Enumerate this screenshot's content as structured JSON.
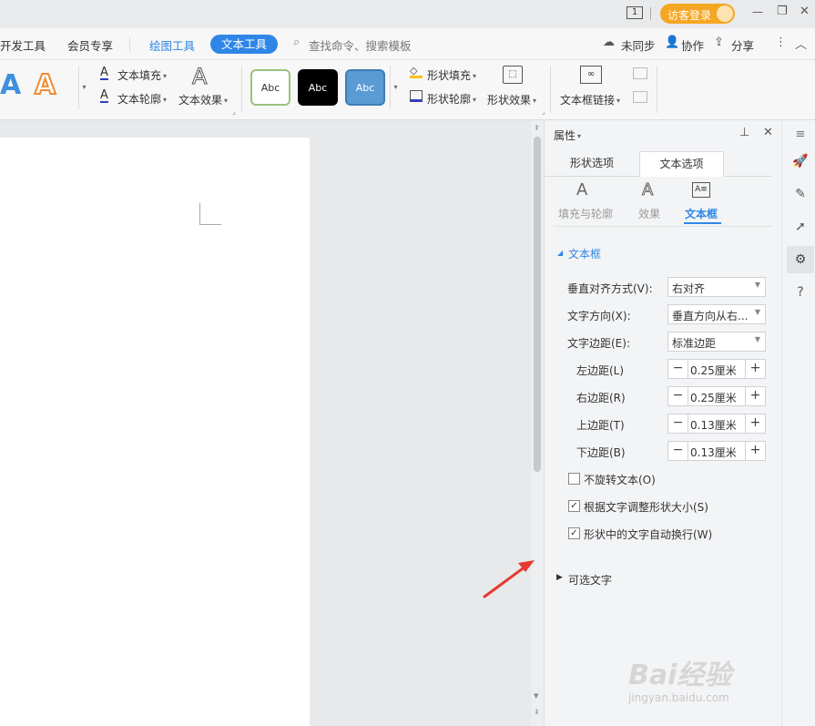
{
  "titlebar": {
    "page_count": "1",
    "login_label": "访客登录",
    "minimize": "—",
    "restore": "❐",
    "close": "✕"
  },
  "tabs": {
    "dev_tools": "开发工具",
    "member": "会员专享",
    "drawing_tools": "绘图工具",
    "text_tools": "文本工具",
    "search_placeholder": "查找命令、搜索模板",
    "unsync": "未同步",
    "collab": "协作",
    "share": "分享"
  },
  "ribbon": {
    "text_fill": "文本填充",
    "text_outline": "文本轮廓",
    "text_effect": "文本效果",
    "style_samples": [
      "Abc",
      "Abc",
      "Abc"
    ],
    "shape_fill": "形状填充",
    "shape_outline": "形状轮廓",
    "shape_effect": "形状效果",
    "textbox_link": "文本框链接"
  },
  "panel": {
    "title": "属性",
    "tab_shape": "形状选项",
    "tab_text": "文本选项",
    "sub_fill": "填充与轮廓",
    "sub_effect": "效果",
    "sub_textbox": "文本框",
    "section_textbox": "文本框",
    "valign_label": "垂直对齐方式(V):",
    "valign_value": "右对齐",
    "direction_label": "文字方向(X):",
    "direction_value": "垂直方向从右...",
    "margin_label": "文字边距(E):",
    "margin_value": "标准边距",
    "left_label": "左边距(L)",
    "left_value": "0.25厘米",
    "right_label": "右边距(R)",
    "right_value": "0.25厘米",
    "top_label": "上边距(T)",
    "top_value": "0.13厘米",
    "bottom_label": "下边距(B)",
    "bottom_value": "0.13厘米",
    "no_rotate": "不旋转文本(O)",
    "resize_shape": "根据文字调整形状大小(S)",
    "wrap_text": "形状中的文字自动换行(W)",
    "alt_text": "可选文字"
  },
  "checkboxes": {
    "no_rotate": false,
    "resize_shape": true,
    "wrap_text": true
  },
  "watermark": {
    "brand": "Bai经验",
    "url": "jingyan.baidu.com"
  },
  "colors": {
    "accent": "#2f86e6",
    "login_orange": "#f5a623",
    "arrow_red": "#e53a2f"
  }
}
